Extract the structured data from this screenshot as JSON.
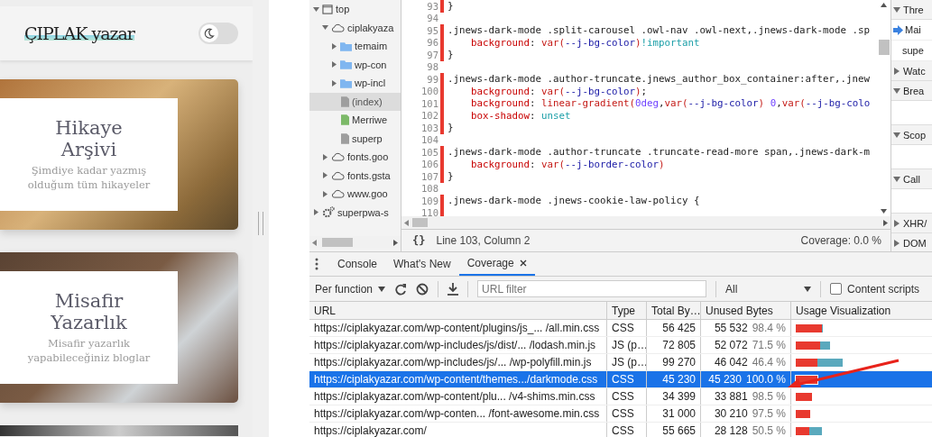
{
  "page": {
    "logo": "ÇIPLAK yazar",
    "dark_mode_toggle": {
      "on": false
    },
    "cards": [
      {
        "title": "Hikaye Arşivi",
        "subtitle": "Şimdiye kadar yazmış olduğum tüm hikayeler"
      },
      {
        "title": "Misafir Yazarlık",
        "subtitle": "Misafir yazarlık yapabileceğiniz bloglar"
      }
    ]
  },
  "file_tree": [
    {
      "label": "top",
      "kind": "frame",
      "expanded": true,
      "selected": false,
      "children": [
        {
          "label": "ciplakyaza",
          "kind": "origin",
          "expanded": true,
          "selected": false,
          "children": [
            {
              "label": "temaim",
              "kind": "folder",
              "expanded": false,
              "selected": false
            },
            {
              "label": "wp-con",
              "kind": "folder",
              "expanded": false,
              "selected": false
            },
            {
              "label": "wp-incl",
              "kind": "folder",
              "expanded": false,
              "selected": false
            },
            {
              "label": "(index)",
              "kind": "file",
              "color": "#9e9e9e",
              "selected": true
            },
            {
              "label": "Merriwe",
              "kind": "file",
              "color": "#7cb968",
              "selected": false
            },
            {
              "label": "superp",
              "kind": "file",
              "color": "#9e9e9e",
              "selected": false
            }
          ]
        },
        {
          "label": "fonts.goo",
          "kind": "origin",
          "expanded": false,
          "selected": false
        },
        {
          "label": "fonts.gsta",
          "kind": "origin",
          "expanded": false,
          "selected": false
        },
        {
          "label": "www.goo",
          "kind": "origin",
          "expanded": false,
          "selected": false
        }
      ]
    },
    {
      "label": "superpwa-s",
      "kind": "worker",
      "expanded": false,
      "selected": false
    }
  ],
  "editor": {
    "lines": [
      {
        "num": "93",
        "unused": true,
        "segments": [
          {
            "kind": "punc",
            "text": "}"
          }
        ]
      },
      {
        "num": "94",
        "unused": false
      },
      {
        "num": "95",
        "unused": true,
        "segments": [
          {
            "kind": "sel",
            "text": ".jnews-dark-mode .split-carousel .owl-nav .owl-next,.jnews-dark-mode .sp"
          }
        ]
      },
      {
        "num": "96",
        "unused": true,
        "segments": [
          {
            "kind": "prop",
            "text": "    background"
          },
          {
            "kind": "punc",
            "text": ": "
          },
          {
            "kind": "fn",
            "text": "var("
          },
          {
            "kind": "arg",
            "text": "--j-bg-color"
          },
          {
            "kind": "fn",
            "text": ")"
          },
          {
            "kind": "kw",
            "text": "!important"
          }
        ]
      },
      {
        "num": "97",
        "unused": true,
        "segments": [
          {
            "kind": "punc",
            "text": "}"
          }
        ]
      },
      {
        "num": "98",
        "unused": false
      },
      {
        "num": "99",
        "unused": true,
        "segments": [
          {
            "kind": "sel",
            "text": ".jnews-dark-mode .author-truncate.jnews_author_box_container:after,.jnew"
          }
        ]
      },
      {
        "num": "100",
        "unused": true,
        "segments": [
          {
            "kind": "prop",
            "text": "    background"
          },
          {
            "kind": "punc",
            "text": ": "
          },
          {
            "kind": "fn",
            "text": "var("
          },
          {
            "kind": "arg",
            "text": "--j-bg-color"
          },
          {
            "kind": "fn",
            "text": ")"
          },
          {
            "kind": "punc",
            "text": ";"
          }
        ]
      },
      {
        "num": "101",
        "unused": true,
        "segments": [
          {
            "kind": "prop",
            "text": "    background"
          },
          {
            "kind": "punc",
            "text": ": "
          },
          {
            "kind": "fn",
            "text": "linear-gradient("
          },
          {
            "kind": "num",
            "text": "0deg"
          },
          {
            "kind": "punc",
            "text": ","
          },
          {
            "kind": "fn",
            "text": "var("
          },
          {
            "kind": "arg",
            "text": "--j-bg-color"
          },
          {
            "kind": "fn",
            "text": ") "
          },
          {
            "kind": "num",
            "text": "0"
          },
          {
            "kind": "punc",
            "text": ","
          },
          {
            "kind": "fn",
            "text": "var("
          },
          {
            "kind": "arg",
            "text": "--j-bg-colo"
          }
        ]
      },
      {
        "num": "102",
        "unused": true,
        "segments": [
          {
            "kind": "prop",
            "text": "    box-shadow"
          },
          {
            "kind": "punc",
            "text": ": "
          },
          {
            "kind": "kw",
            "text": "unset"
          }
        ]
      },
      {
        "num": "103",
        "unused": true,
        "segments": [
          {
            "kind": "punc",
            "text": "}"
          }
        ]
      },
      {
        "num": "104",
        "unused": false
      },
      {
        "num": "105",
        "unused": true,
        "segments": [
          {
            "kind": "sel",
            "text": ".jnews-dark-mode .author-truncate .truncate-read-more span,.jnews-dark-m"
          }
        ]
      },
      {
        "num": "106",
        "unused": true,
        "segments": [
          {
            "kind": "prop",
            "text": "    background"
          },
          {
            "kind": "punc",
            "text": ": "
          },
          {
            "kind": "fn",
            "text": "var("
          },
          {
            "kind": "arg",
            "text": "--j-border-color"
          },
          {
            "kind": "fn",
            "text": ")"
          }
        ]
      },
      {
        "num": "107",
        "unused": true,
        "segments": [
          {
            "kind": "punc",
            "text": "}"
          }
        ]
      },
      {
        "num": "108",
        "unused": false
      },
      {
        "num": "109",
        "unused": true,
        "segments": [
          {
            "kind": "sel",
            "text": ".jnews-dark-mode .jnews-cookie-law-policy {"
          }
        ]
      },
      {
        "num": "110",
        "unused": true
      }
    ],
    "status": {
      "format_icon": "{}",
      "position": "Line 103, Column 2",
      "coverage": "Coverage: 0.0 %"
    }
  },
  "debugger": [
    {
      "title": "Thre",
      "expanded": true,
      "items": [
        {
          "label": "Mai",
          "selected": true
        },
        {
          "label": "supe",
          "selected": false
        }
      ]
    },
    {
      "title": "Watc",
      "expanded": false
    },
    {
      "title": "Brea",
      "expanded": true
    },
    {
      "title": "Scop",
      "expanded": true
    },
    {
      "title": "Call",
      "expanded": true
    },
    {
      "title": "XHR/",
      "expanded": false
    },
    {
      "title": "DOM",
      "expanded": false
    }
  ],
  "drawer_tabs": [
    {
      "label": "Console",
      "selected": false,
      "closable": false
    },
    {
      "label": "What's New",
      "selected": false,
      "closable": false
    },
    {
      "label": "Coverage",
      "selected": true,
      "closable": true
    }
  ],
  "coverage_toolbar": {
    "mode": "Per function",
    "url_filter": {
      "placeholder": "URL filter"
    },
    "type_filter": "All",
    "content_scripts": {
      "label": "Content scripts",
      "checked": false
    }
  },
  "table": {
    "columns": [
      "URL",
      "Type",
      "Total By…",
      "Unused Bytes",
      "Usage Visualization"
    ],
    "rows": [
      {
        "url": "https://ciplakyazar.com/wp-content/plugins/js_... /all.min.css",
        "type": "CSS",
        "total": "56 425",
        "unused": "55 532",
        "percent": "98.4 %",
        "level": 0.984,
        "selected": false
      },
      {
        "url": "https://ciplakyazar.com/wp-includes/js/dist/... /lodash.min.js",
        "type": "JS (p…",
        "total": "72 805",
        "unused": "52 072",
        "percent": "71.5 %",
        "level": 0.715,
        "selected": false
      },
      {
        "url": "https://ciplakyazar.com/wp-includes/js/...   /wp-polyfill.min.js",
        "type": "JS (p…",
        "total": "99 270",
        "unused": "46 042",
        "percent": "46.4 %",
        "level": 0.464,
        "selected": false
      },
      {
        "url": "https://ciplakyazar.com/wp-content/themes.../darkmode.css",
        "type": "CSS",
        "total": "45 230",
        "unused": "45 230",
        "percent": "100.0 %",
        "level": 1.0,
        "selected": true
      },
      {
        "url": "https://ciplakyazar.com/wp-content/plu...   /v4-shims.min.css",
        "type": "CSS",
        "total": "34 399",
        "unused": "33 881",
        "percent": "98.5 %",
        "level": 0.985,
        "selected": false
      },
      {
        "url": "https://ciplakyazar.com/wp-conten... /font-awesome.min.css",
        "type": "CSS",
        "total": "31 000",
        "unused": "30 210",
        "percent": "97.5 %",
        "level": 0.975,
        "selected": false
      },
      {
        "url": "https://ciplakyazar.com/",
        "type": "CSS",
        "total": "55 665",
        "unused": "28 128",
        "percent": "50.5 %",
        "level": 0.505,
        "selected": false
      }
    ]
  }
}
